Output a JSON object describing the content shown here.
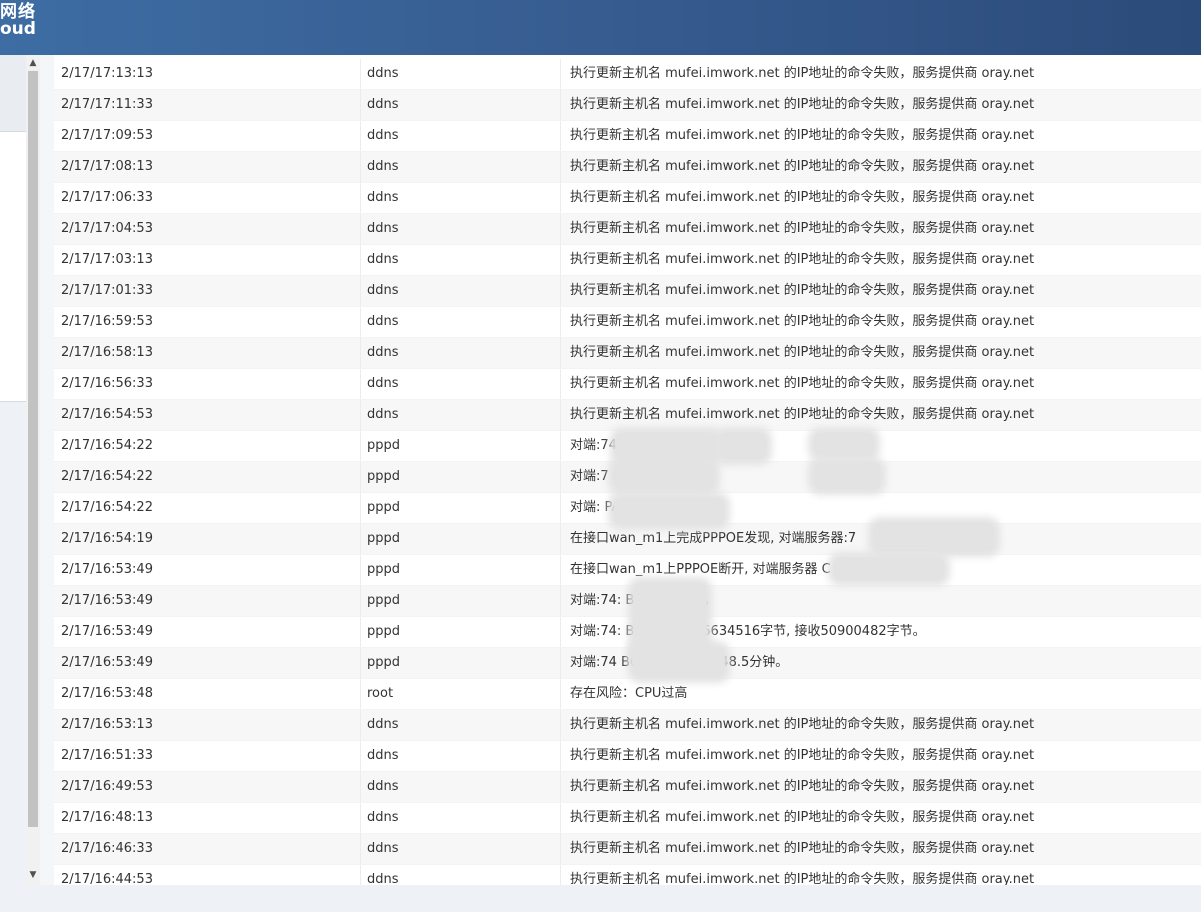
{
  "logo": {
    "line1": "网络",
    "line2": "oud"
  },
  "log": {
    "rows": [
      {
        "time": "2/17/17:13:13",
        "source": "ddns",
        "message": "执行更新主机名 mufei.imwork.net 的IP地址的命令失败，服务提供商 oray.net"
      },
      {
        "time": "2/17/17:11:33",
        "source": "ddns",
        "message": "执行更新主机名 mufei.imwork.net 的IP地址的命令失败，服务提供商 oray.net"
      },
      {
        "time": "2/17/17:09:53",
        "source": "ddns",
        "message": "执行更新主机名 mufei.imwork.net 的IP地址的命令失败，服务提供商 oray.net"
      },
      {
        "time": "2/17/17:08:13",
        "source": "ddns",
        "message": "执行更新主机名 mufei.imwork.net 的IP地址的命令失败，服务提供商 oray.net"
      },
      {
        "time": "2/17/17:06:33",
        "source": "ddns",
        "message": "执行更新主机名 mufei.imwork.net 的IP地址的命令失败，服务提供商 oray.net"
      },
      {
        "time": "2/17/17:04:53",
        "source": "ddns",
        "message": "执行更新主机名 mufei.imwork.net 的IP地址的命令失败，服务提供商 oray.net"
      },
      {
        "time": "2/17/17:03:13",
        "source": "ddns",
        "message": "执行更新主机名 mufei.imwork.net 的IP地址的命令失败，服务提供商 oray.net"
      },
      {
        "time": "2/17/17:01:33",
        "source": "ddns",
        "message": "执行更新主机名 mufei.imwork.net 的IP地址的命令失败，服务提供商 oray.net"
      },
      {
        "time": "2/17/16:59:53",
        "source": "ddns",
        "message": "执行更新主机名 mufei.imwork.net 的IP地址的命令失败，服务提供商 oray.net"
      },
      {
        "time": "2/17/16:58:13",
        "source": "ddns",
        "message": "执行更新主机名 mufei.imwork.net 的IP地址的命令失败，服务提供商 oray.net"
      },
      {
        "time": "2/17/16:56:33",
        "source": "ddns",
        "message": "执行更新主机名 mufei.imwork.net 的IP地址的命令失败，服务提供商 oray.net"
      },
      {
        "time": "2/17/16:54:53",
        "source": "ddns",
        "message": "执行更新主机名 mufei.imwork.net 的IP地址的命令失败，服务提供商 oray.net"
      },
      {
        "time": "2/17/16:54:22",
        "source": "pppd",
        "message": "对端:74                        C, 对端IP地址为"
      },
      {
        "time": "2/17/16:54:22",
        "source": "pppd",
        "message": "对端:7                         C, 本地IP地址为"
      },
      {
        "time": "2/17/16:54:22",
        "source": "pppd",
        "message": "对端:                             PAP认证成功"
      },
      {
        "time": "2/17/16:54:19",
        "source": "pppd",
        "message": "在接口wan_m1上完成PPPOE发现, 对端服务器:7"
      },
      {
        "time": "2/17/16:53:49",
        "source": "pppd",
        "message": "在接口wan_m1上PPPOE断开, 对端服务器                           C"
      },
      {
        "time": "2/17/16:53:49",
        "source": "pppd",
        "message": "对端:74:                   BC, 连接终止。"
      },
      {
        "time": "2/17/16:53:49",
        "source": "pppd",
        "message": "对端:74:                   BC, 发送1356634516字节, 接收50900482字节。"
      },
      {
        "time": "2/17/16:53:49",
        "source": "pppd",
        "message": "对端:74                    BC, 接入时间为148.5分钟。"
      },
      {
        "time": "2/17/16:53:48",
        "source": "root",
        "message": "存在风险：CPU过高"
      },
      {
        "time": "2/17/16:53:13",
        "source": "ddns",
        "message": "执行更新主机名 mufei.imwork.net 的IP地址的命令失败，服务提供商 oray.net"
      },
      {
        "time": "2/17/16:51:33",
        "source": "ddns",
        "message": "执行更新主机名 mufei.imwork.net 的IP地址的命令失败，服务提供商 oray.net"
      },
      {
        "time": "2/17/16:49:53",
        "source": "ddns",
        "message": "执行更新主机名 mufei.imwork.net 的IP地址的命令失败，服务提供商 oray.net"
      },
      {
        "time": "2/17/16:48:13",
        "source": "ddns",
        "message": "执行更新主机名 mufei.imwork.net 的IP地址的命令失败，服务提供商 oray.net"
      },
      {
        "time": "2/17/16:46:33",
        "source": "ddns",
        "message": "执行更新主机名 mufei.imwork.net 的IP地址的命令失败，服务提供商 oray.net"
      },
      {
        "time": "2/17/16:44:53",
        "source": "ddns",
        "message": "执行更新主机名 mufei.imwork.net 的IP地址的命令失败，服务提供商 oray.net"
      }
    ]
  },
  "scrollbar": {
    "up_icon": "▲",
    "down_icon": "▼"
  }
}
